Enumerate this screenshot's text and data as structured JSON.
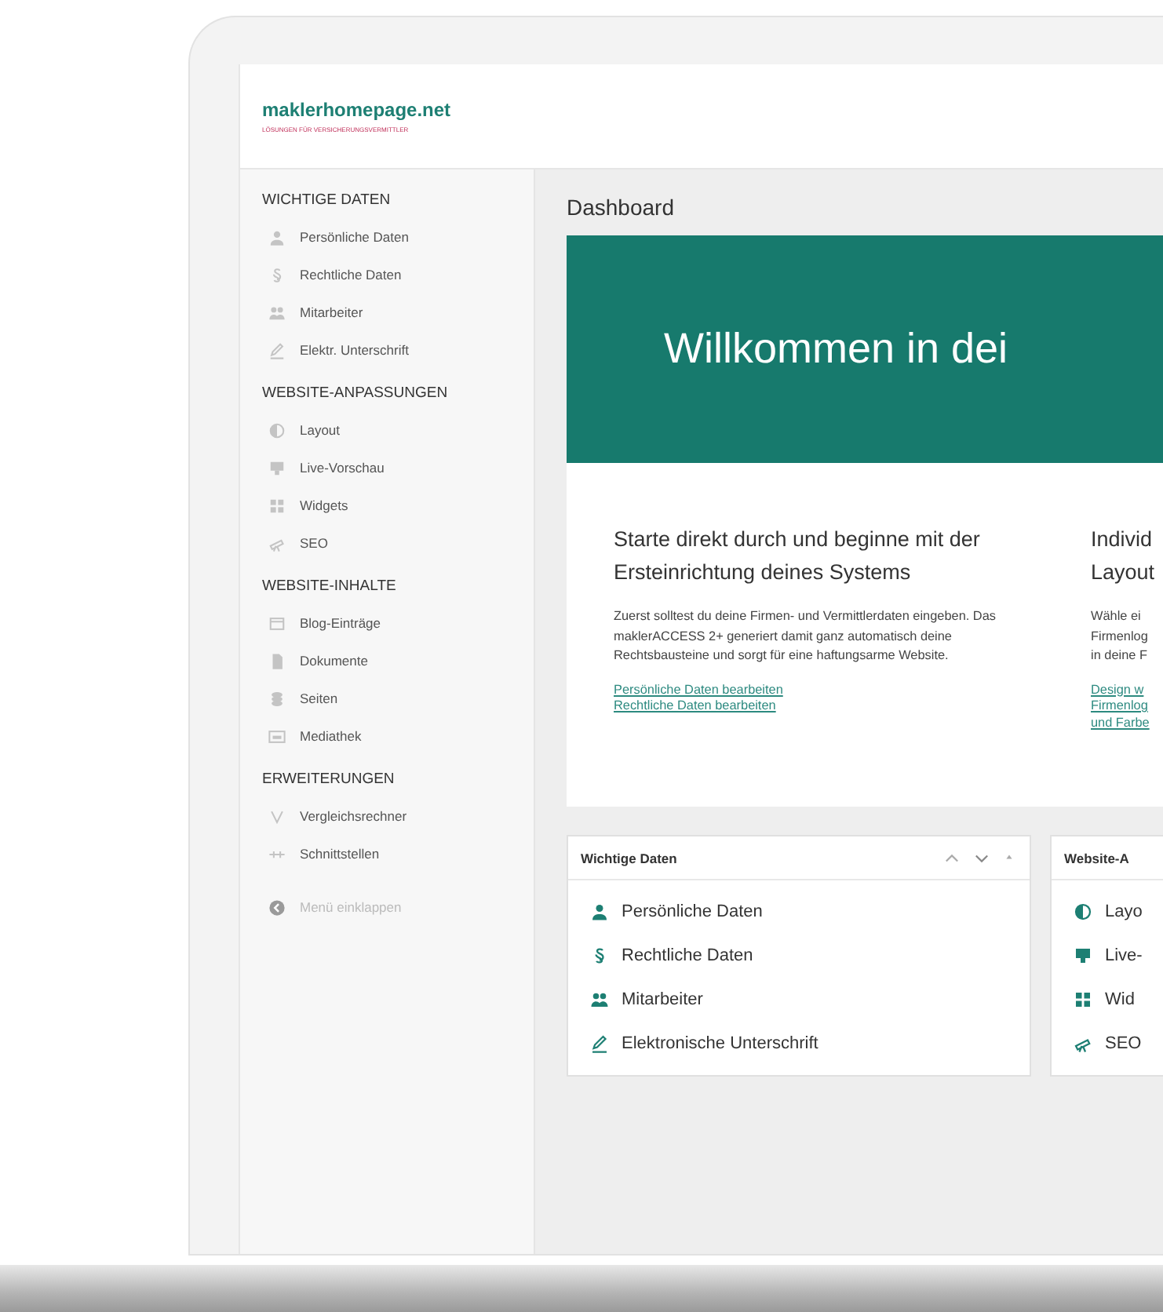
{
  "brand": {
    "name": "maklerhomepage.net",
    "tagline": "LÖSUNGEN FÜR VERSICHERUNGSVERMITTLER"
  },
  "sidebar": {
    "sections": [
      {
        "title": "WICHTIGE DATEN",
        "items": [
          "Persönliche Daten",
          "Rechtliche Daten",
          "Mitarbeiter",
          "Elektr. Unterschrift"
        ]
      },
      {
        "title": "WEBSITE-ANPASSUNGEN",
        "items": [
          "Layout",
          "Live-Vorschau",
          "Widgets",
          "SEO"
        ]
      },
      {
        "title": "WEBSITE-INHALTE",
        "items": [
          "Blog-Einträge",
          "Dokumente",
          "Seiten",
          "Mediathek"
        ]
      },
      {
        "title": "ERWEITERUNGEN",
        "items": [
          "Vergleichsrechner",
          "Schnittstellen"
        ]
      }
    ],
    "collapse": {
      "label": "Menü einklappen",
      "disabled": true
    }
  },
  "page_title": "Dashboard",
  "banner": {
    "text": "Willkommen in dei"
  },
  "intro_columns": [
    {
      "heading": [
        "Starte direkt durch und beginne mit der Ersteinrichtung deines Systems"
      ],
      "body": [
        "Zuerst solltest du deine Firmen- und Vermittlerdaten eingeben. Das maklerACCESS 2+ generiert damit ganz automatisch deine Rechtsbausteine und sorgt für eine haftungsarme Website."
      ],
      "links": [
        "Persönliche Daten bearbeiten",
        "Rechtliche Daten bearbeiten"
      ]
    },
    {
      "heading": [
        "Individ",
        "Layout"
      ],
      "body": [
        "Wähle ei",
        "Firmenlog",
        "in deine F"
      ],
      "links": [
        "Design w",
        "Firmenlog",
        "und Farbe"
      ]
    }
  ],
  "widgets": [
    {
      "title": "Wichtige Daten",
      "controls": true,
      "items": [
        "Persönliche Daten",
        "Rechtliche Daten",
        "Mitarbeiter",
        "Elektronische Unterschrift"
      ]
    },
    {
      "title": "Website-A",
      "controls": false,
      "items": [
        "Layo",
        "Live-",
        "Wid",
        "SEO"
      ]
    }
  ]
}
